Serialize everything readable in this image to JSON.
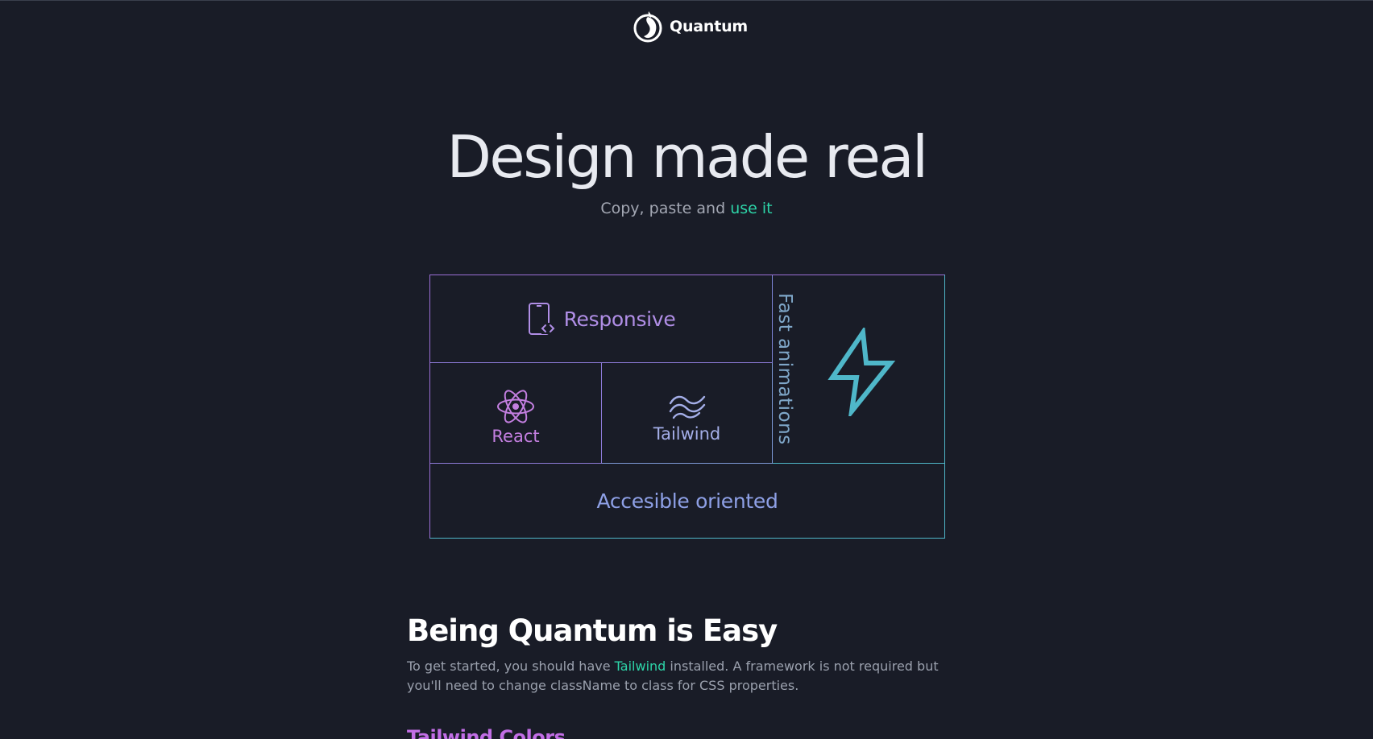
{
  "header": {
    "brand_name": "Quantum",
    "logo_icon": "quantum-logo-icon"
  },
  "hero": {
    "title": "Design made real",
    "subtitle_prefix": "Copy, paste and",
    "subtitle_accent": "use it"
  },
  "features": {
    "responsive": {
      "label": "Responsive",
      "icon": "mobile-code-icon"
    },
    "react": {
      "label": "React",
      "icon": "react-atom-icon"
    },
    "tailwind": {
      "label": "Tailwind",
      "icon": "tailwind-waves-icon"
    },
    "fast": {
      "label": "Fast animations",
      "icon": "lightning-bolt-icon"
    },
    "accessible": {
      "label": "Accesible oriented"
    }
  },
  "section": {
    "title": "Being Quantum is Easy",
    "text_before": "To get started, you should have",
    "text_accent": "Tailwind",
    "text_after": "installed. A framework is not required but you'll need to change className to class for CSS properties.",
    "next_title": "Tailwind Colors"
  },
  "colors": {
    "background": "#191c27",
    "accent_green": "#2dd4a8",
    "accent_purple": "#b08ee6",
    "accent_cyan": "#4fb7c9"
  }
}
